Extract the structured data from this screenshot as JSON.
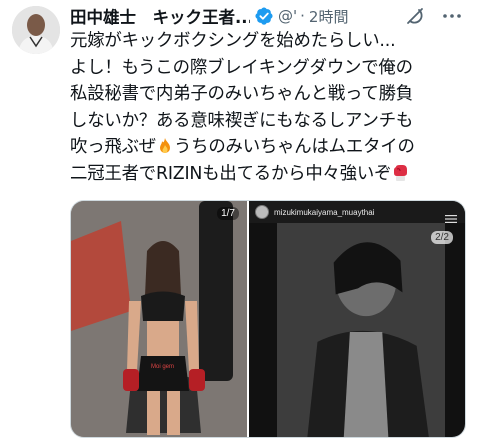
{
  "tweet": {
    "author_name": "田中雄士　キック王者...",
    "handle": "@'",
    "separator": "·",
    "time": "2時間",
    "text_lines": [
      "元嫁がキックボクシングを始めたらしい...",
      "よし！もうこの際ブレイキングダウンで俺の",
      "私設秘書で内弟子のみいちゃんと戦って勝負",
      "しないか？ある意味禊ぎにもなるしアンチも",
      "吹っ飛ぶぜ",
      "うちのみいちゃんはムエタイの",
      "二冠王者でRIZINも出てるから中々強いぞ"
    ],
    "icons": {
      "verified": "verified-badge-icon",
      "grok": "grok-icon",
      "more": "more-icon",
      "fire": "fire-emoji",
      "glove": "boxing-glove-emoji"
    },
    "colors": {
      "verified": "#1d9bf0",
      "text": "#0f1419",
      "secondary": "#536471"
    }
  },
  "media": {
    "photo1": {
      "counter": "1/7",
      "shorts_text": "Moi gem"
    },
    "photo2": {
      "counter": "2/2",
      "instagram_user": "mizukimukaiyama_muaythai"
    }
  }
}
